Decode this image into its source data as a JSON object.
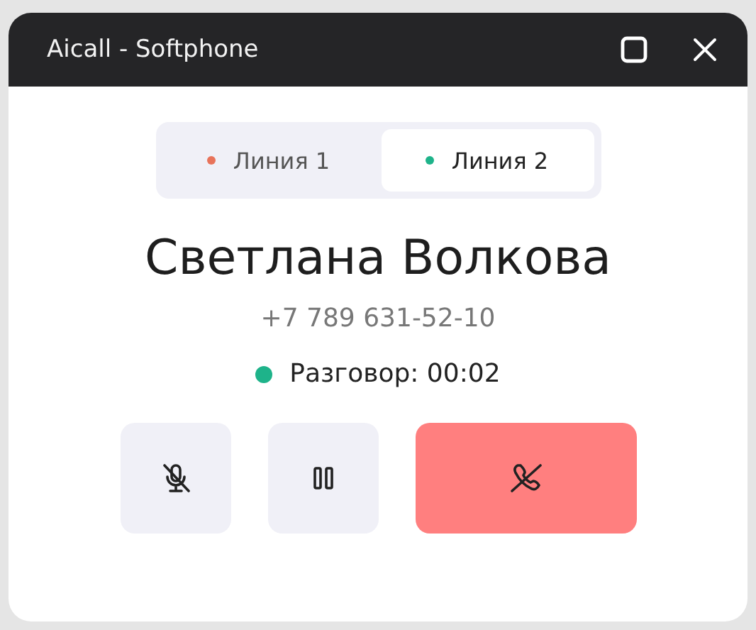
{
  "window": {
    "title": "Aicall - Softphone"
  },
  "lines": [
    {
      "label": "Линия 1",
      "selected": false,
      "color": "#e8735a"
    },
    {
      "label": "Линия 2",
      "selected": true,
      "color": "#1eb38a"
    }
  ],
  "contact": {
    "name": "Светлана Волкова",
    "phone": "+7 789 631-52-10"
  },
  "status": {
    "text": "Разговор: 00:02",
    "color": "#1eb38a"
  },
  "actions": [
    {
      "kind": "mute"
    },
    {
      "kind": "hold"
    },
    {
      "kind": "hangup"
    }
  ]
}
